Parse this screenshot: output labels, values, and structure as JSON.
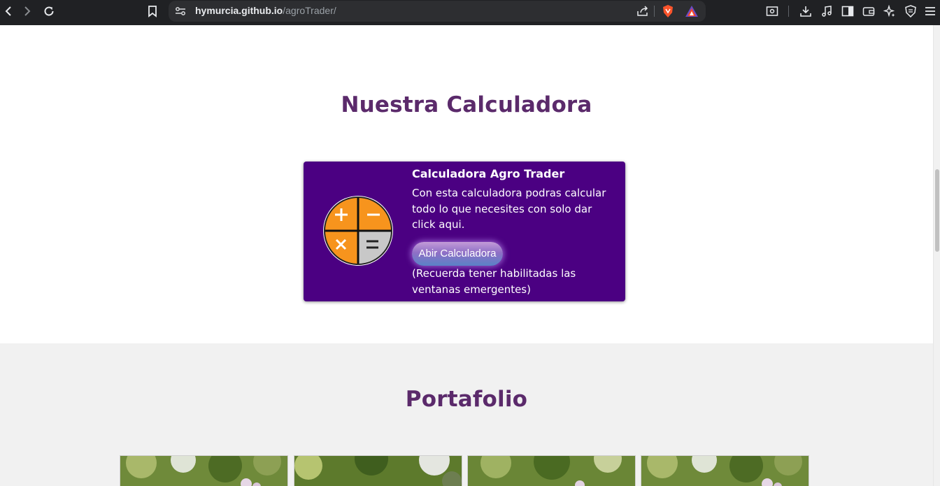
{
  "browser": {
    "url_host": "hymurcia.github.io",
    "url_path": "/agroTrader/",
    "icons": {
      "back": "back-arrow-icon",
      "forward": "forward-arrow-icon",
      "reload": "reload-icon",
      "bookmark": "bookmark-icon",
      "site_info": "site-settings-icon",
      "share": "share-icon",
      "brave_shield": "brave-shield-icon",
      "brave_rewards": "brave-rewards-icon",
      "screenshot": "screenshot-icon",
      "downloads": "download-icon",
      "media": "music-icon",
      "sidebar": "sidebar-icon",
      "wallet": "wallet-icon",
      "leo": "leo-ai-icon",
      "vpn": "vpn-shield-icon",
      "menu": "hamburger-menu-icon"
    }
  },
  "calculator_section": {
    "title": "Nuestra Calculadora",
    "card": {
      "title": "Calculadora Agro Trader",
      "description": "Con esta calculadora podras calcular todo lo que necesites con solo dar click aqui.",
      "button_label": "Abir Calculadora",
      "note": "(Recuerda tener habilitadas las ventanas emergentes)",
      "icon": "calculator-icon"
    }
  },
  "portfolio_section": {
    "title": "Portafolio",
    "photos": [
      "plant-photo",
      "plant-photo",
      "plant-photo",
      "plant-photo"
    ]
  },
  "colors": {
    "title": "#5b2a6b",
    "card_bg": "#4b0082",
    "portfolio_bg": "#f1f1f1",
    "calc_orange": "#f7941d",
    "calc_gray": "#c8c8c8"
  }
}
